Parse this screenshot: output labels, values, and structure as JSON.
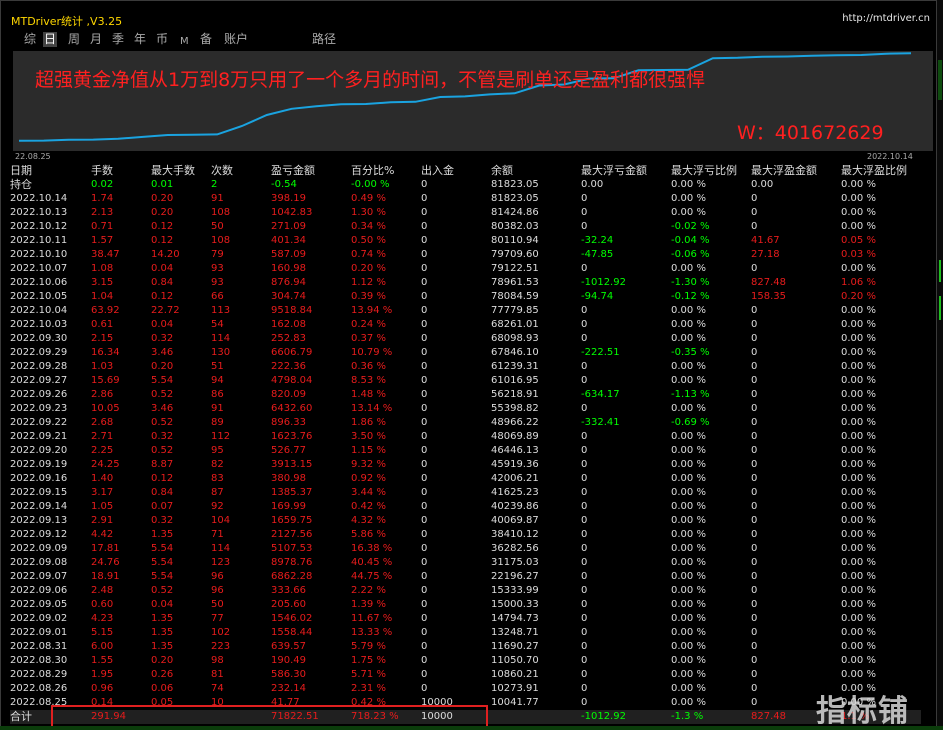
{
  "app": {
    "title": "MTDriver统计 ,V3.25",
    "url": "http://mtdriver.cn"
  },
  "tabs": [
    {
      "label": "综",
      "active": false
    },
    {
      "label": "日",
      "active": true
    },
    {
      "label": "周",
      "active": false
    },
    {
      "label": "月",
      "active": false
    },
    {
      "label": "季",
      "active": false
    },
    {
      "label": "年",
      "active": false
    },
    {
      "label": "币",
      "active": false
    },
    {
      "label": "M",
      "active": false
    },
    {
      "label": "备",
      "active": false
    },
    {
      "label": "账户",
      "active": false
    },
    {
      "label": "路径",
      "active": false
    }
  ],
  "chart": {
    "annotation": "超强黄金净值从1万到8万只用了一个多月的时间，不管是刷单还是盈利都很强悍",
    "contact": "W：401672629",
    "date_start": "22.08.25",
    "date_end": "2022.10.14",
    "line_color": "#1aa3e0",
    "annotation_color": "#ff2020"
  },
  "chart_data": {
    "type": "line",
    "x": [
      "2022.08.25",
      "2022.08.26",
      "2022.08.29",
      "2022.08.30",
      "2022.08.31",
      "2022.09.01",
      "2022.09.02",
      "2022.09.05",
      "2022.09.06",
      "2022.09.07",
      "2022.09.08",
      "2022.09.09",
      "2022.09.12",
      "2022.09.13",
      "2022.09.14",
      "2022.09.15",
      "2022.09.16",
      "2022.09.19",
      "2022.09.20",
      "2022.09.21",
      "2022.09.22",
      "2022.09.23",
      "2022.09.26",
      "2022.09.27",
      "2022.09.28",
      "2022.09.29",
      "2022.09.30",
      "2022.10.03",
      "2022.10.04",
      "2022.10.05",
      "2022.10.06",
      "2022.10.07",
      "2022.10.10",
      "2022.10.11",
      "2022.10.12",
      "2022.10.13",
      "2022.10.14"
    ],
    "y": [
      10041.77,
      10273.91,
      10860.21,
      11050.7,
      11690.27,
      13248.71,
      14794.73,
      15000.33,
      15333.99,
      22196.27,
      31175.03,
      36282.56,
      38410.12,
      40069.87,
      40239.86,
      41625.23,
      42006.21,
      45919.36,
      46444.13,
      48069.89,
      48966.22,
      55398.82,
      56218.91,
      61016.95,
      61239.31,
      67846.1,
      68098.93,
      68261.01,
      77779.85,
      78084.59,
      78961.53,
      79122.51,
      79709.6,
      80110.94,
      80382.03,
      81424.86,
      81823.05
    ]
  },
  "table": {
    "headers": [
      "日期",
      "手数",
      "最大手数",
      "次数",
      "盈亏金额",
      "百分比%",
      "出入金",
      "余额",
      "最大浮亏金额",
      "最大浮亏比例",
      "最大浮盈金额",
      "最大浮盈比例"
    ],
    "holding": [
      "持仓",
      "0.02",
      "0.01",
      "2",
      "-0.54",
      "-0.00 %",
      "0",
      "81823.05",
      "0.00",
      "0.00 %",
      "0.00",
      "0.00 %"
    ],
    "rows": [
      [
        "2022.10.14",
        "1.74",
        "0.20",
        "91",
        "398.19",
        "0.49 %",
        "0",
        "81823.05",
        "0",
        "0.00 %",
        "0",
        "0.00 %"
      ],
      [
        "2022.10.13",
        "2.13",
        "0.20",
        "108",
        "1042.83",
        "1.30 %",
        "0",
        "81424.86",
        "0",
        "0.00 %",
        "0",
        "0.00 %"
      ],
      [
        "2022.10.12",
        "0.71",
        "0.12",
        "50",
        "271.09",
        "0.34 %",
        "0",
        "80382.03",
        "0",
        "-0.02 %",
        "0",
        "0.00 %"
      ],
      [
        "2022.10.11",
        "1.57",
        "0.12",
        "108",
        "401.34",
        "0.50 %",
        "0",
        "80110.94",
        "-32.24",
        "-0.04 %",
        "41.67",
        "0.05 %"
      ],
      [
        "2022.10.10",
        "38.47",
        "14.20",
        "79",
        "587.09",
        "0.74 %",
        "0",
        "79709.60",
        "-47.85",
        "-0.06 %",
        "27.18",
        "0.03 %"
      ],
      [
        "2022.10.07",
        "1.08",
        "0.04",
        "93",
        "160.98",
        "0.20 %",
        "0",
        "79122.51",
        "0",
        "0.00 %",
        "0",
        "0.00 %"
      ],
      [
        "2022.10.06",
        "3.15",
        "0.84",
        "93",
        "876.94",
        "1.12 %",
        "0",
        "78961.53",
        "-1012.92",
        "-1.30 %",
        "827.48",
        "1.06 %"
      ],
      [
        "2022.10.05",
        "1.04",
        "0.12",
        "66",
        "304.74",
        "0.39 %",
        "0",
        "78084.59",
        "-94.74",
        "-0.12 %",
        "158.35",
        "0.20 %"
      ],
      [
        "2022.10.04",
        "63.92",
        "22.72",
        "113",
        "9518.84",
        "13.94 %",
        "0",
        "77779.85",
        "0",
        "0.00 %",
        "0",
        "0.00 %"
      ],
      [
        "2022.10.03",
        "0.61",
        "0.04",
        "54",
        "162.08",
        "0.24 %",
        "0",
        "68261.01",
        "0",
        "0.00 %",
        "0",
        "0.00 %"
      ],
      [
        "2022.09.30",
        "2.15",
        "0.32",
        "114",
        "252.83",
        "0.37 %",
        "0",
        "68098.93",
        "0",
        "0.00 %",
        "0",
        "0.00 %"
      ],
      [
        "2022.09.29",
        "16.34",
        "3.46",
        "130",
        "6606.79",
        "10.79 %",
        "0",
        "67846.10",
        "-222.51",
        "-0.35 %",
        "0",
        "0.00 %"
      ],
      [
        "2022.09.28",
        "1.03",
        "0.20",
        "51",
        "222.36",
        "0.36 %",
        "0",
        "61239.31",
        "0",
        "0.00 %",
        "0",
        "0.00 %"
      ],
      [
        "2022.09.27",
        "15.69",
        "5.54",
        "94",
        "4798.04",
        "8.53 %",
        "0",
        "61016.95",
        "0",
        "0.00 %",
        "0",
        "0.00 %"
      ],
      [
        "2022.09.26",
        "2.86",
        "0.52",
        "86",
        "820.09",
        "1.48 %",
        "0",
        "56218.91",
        "-634.17",
        "-1.13 %",
        "0",
        "0.00 %"
      ],
      [
        "2022.09.23",
        "10.05",
        "3.46",
        "91",
        "6432.60",
        "13.14 %",
        "0",
        "55398.82",
        "0",
        "0.00 %",
        "0",
        "0.00 %"
      ],
      [
        "2022.09.22",
        "2.68",
        "0.52",
        "89",
        "896.33",
        "1.86 %",
        "0",
        "48966.22",
        "-332.41",
        "-0.69 %",
        "0",
        "0.00 %"
      ],
      [
        "2022.09.21",
        "2.71",
        "0.32",
        "112",
        "1623.76",
        "3.50 %",
        "0",
        "48069.89",
        "0",
        "0.00 %",
        "0",
        "0.00 %"
      ],
      [
        "2022.09.20",
        "2.25",
        "0.52",
        "95",
        "526.77",
        "1.15 %",
        "0",
        "46446.13",
        "0",
        "0.00 %",
        "0",
        "0.00 %"
      ],
      [
        "2022.09.19",
        "24.25",
        "8.87",
        "82",
        "3913.15",
        "9.32 %",
        "0",
        "45919.36",
        "0",
        "0.00 %",
        "0",
        "0.00 %"
      ],
      [
        "2022.09.16",
        "1.40",
        "0.12",
        "83",
        "380.98",
        "0.92 %",
        "0",
        "42006.21",
        "0",
        "0.00 %",
        "0",
        "0.00 %"
      ],
      [
        "2022.09.15",
        "3.17",
        "0.84",
        "87",
        "1385.37",
        "3.44 %",
        "0",
        "41625.23",
        "0",
        "0.00 %",
        "0",
        "0.00 %"
      ],
      [
        "2022.09.14",
        "1.05",
        "0.07",
        "92",
        "169.99",
        "0.42 %",
        "0",
        "40239.86",
        "0",
        "0.00 %",
        "0",
        "0.00 %"
      ],
      [
        "2022.09.13",
        "2.91",
        "0.32",
        "104",
        "1659.75",
        "4.32 %",
        "0",
        "40069.87",
        "0",
        "0.00 %",
        "0",
        "0.00 %"
      ],
      [
        "2022.09.12",
        "4.42",
        "1.35",
        "71",
        "2127.56",
        "5.86 %",
        "0",
        "38410.12",
        "0",
        "0.00 %",
        "0",
        "0.00 %"
      ],
      [
        "2022.09.09",
        "17.81",
        "5.54",
        "114",
        "5107.53",
        "16.38 %",
        "0",
        "36282.56",
        "0",
        "0.00 %",
        "0",
        "0.00 %"
      ],
      [
        "2022.09.08",
        "24.76",
        "5.54",
        "123",
        "8978.76",
        "40.45 %",
        "0",
        "31175.03",
        "0",
        "0.00 %",
        "0",
        "0.00 %"
      ],
      [
        "2022.09.07",
        "18.91",
        "5.54",
        "96",
        "6862.28",
        "44.75 %",
        "0",
        "22196.27",
        "0",
        "0.00 %",
        "0",
        "0.00 %"
      ],
      [
        "2022.09.06",
        "2.48",
        "0.52",
        "96",
        "333.66",
        "2.22 %",
        "0",
        "15333.99",
        "0",
        "0.00 %",
        "0",
        "0.00 %"
      ],
      [
        "2022.09.05",
        "0.60",
        "0.04",
        "50",
        "205.60",
        "1.39 %",
        "0",
        "15000.33",
        "0",
        "0.00 %",
        "0",
        "0.00 %"
      ],
      [
        "2022.09.02",
        "4.23",
        "1.35",
        "77",
        "1546.02",
        "11.67 %",
        "0",
        "14794.73",
        "0",
        "0.00 %",
        "0",
        "0.00 %"
      ],
      [
        "2022.09.01",
        "5.15",
        "1.35",
        "102",
        "1558.44",
        "13.33 %",
        "0",
        "13248.71",
        "0",
        "0.00 %",
        "0",
        "0.00 %"
      ],
      [
        "2022.08.31",
        "6.00",
        "1.35",
        "223",
        "639.57",
        "5.79 %",
        "0",
        "11690.27",
        "0",
        "0.00 %",
        "0",
        "0.00 %"
      ],
      [
        "2022.08.30",
        "1.55",
        "0.20",
        "98",
        "190.49",
        "1.75 %",
        "0",
        "11050.70",
        "0",
        "0.00 %",
        "0",
        "0.00 %"
      ],
      [
        "2022.08.29",
        "1.95",
        "0.26",
        "81",
        "586.30",
        "5.71 %",
        "0",
        "10860.21",
        "0",
        "0.00 %",
        "0",
        "0.00 %"
      ],
      [
        "2022.08.26",
        "0.96",
        "0.06",
        "74",
        "232.14",
        "2.31 %",
        "0",
        "10273.91",
        "0",
        "0.00 %",
        "0",
        "0.00 %"
      ],
      [
        "2022.08.25",
        "0.14",
        "0.05",
        "10",
        "41.77",
        "0.42 %",
        "10000",
        "10041.77",
        "0",
        "0.00 %",
        "0",
        "0.00 %"
      ]
    ],
    "total": [
      "合计",
      "291.94",
      "",
      "",
      "71822.51",
      "718.23 %",
      "10000",
      "",
      "-1012.92",
      "-1.3 %",
      "827.48",
      "1.1 %"
    ]
  },
  "watermark": "指标铺"
}
